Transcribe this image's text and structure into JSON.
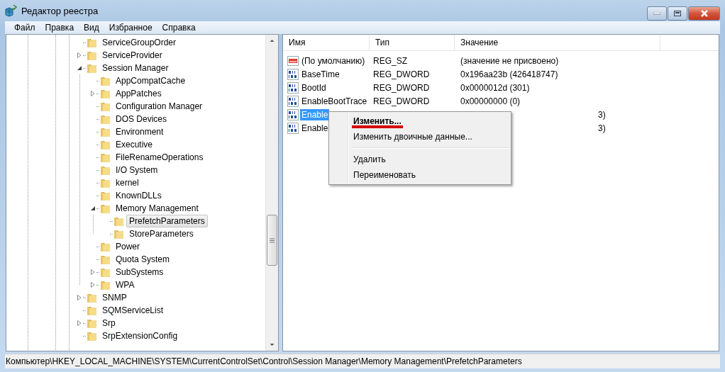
{
  "window": {
    "title": "Редактор реестра"
  },
  "menu": [
    "Файл",
    "Правка",
    "Вид",
    "Избранное",
    "Справка"
  ],
  "tree": [
    {
      "label": "ServiceGroupOrder",
      "selected": false
    },
    {
      "label": "ServiceProvider",
      "expanded": false,
      "selected": false
    },
    {
      "label": "Session Manager",
      "expanded": true,
      "selected": false,
      "children": [
        {
          "label": "AppCompatCache",
          "selected": false
        },
        {
          "label": "AppPatches",
          "expanded": false,
          "selected": false
        },
        {
          "label": "Configuration Manager",
          "selected": false
        },
        {
          "label": "DOS Devices",
          "selected": false
        },
        {
          "label": "Environment",
          "selected": false
        },
        {
          "label": "Executive",
          "selected": false
        },
        {
          "label": "FileRenameOperations",
          "selected": false
        },
        {
          "label": "I/O System",
          "selected": false
        },
        {
          "label": "kernel",
          "selected": false
        },
        {
          "label": "KnownDLLs",
          "selected": false
        },
        {
          "label": "Memory Management",
          "expanded": true,
          "selected": false,
          "children": [
            {
              "label": "PrefetchParameters",
              "selected": true
            },
            {
              "label": "StoreParameters",
              "selected": false
            }
          ]
        },
        {
          "label": "Power",
          "selected": false
        },
        {
          "label": "Quota System",
          "selected": false
        },
        {
          "label": "SubSystems",
          "expanded": false,
          "selected": false
        },
        {
          "label": "WPA",
          "expanded": false,
          "selected": false
        }
      ]
    },
    {
      "label": "SNMP",
      "expanded": false,
      "selected": false
    },
    {
      "label": "SQMServiceList",
      "selected": false
    },
    {
      "label": "Srp",
      "expanded": false,
      "selected": false
    },
    {
      "label": "SrpExtensionConfig",
      "selected": false
    }
  ],
  "table": {
    "columns": [
      "Имя",
      "Тип",
      "Значение"
    ],
    "rows": [
      {
        "kind": "string",
        "name": "(По умолчанию)",
        "type": "REG_SZ",
        "value": "(значение не присвоено)",
        "selected": false
      },
      {
        "kind": "dword",
        "name": "BaseTime",
        "type": "REG_DWORD",
        "value": "0x196aa23b (426418747)",
        "selected": false
      },
      {
        "kind": "dword",
        "name": "BootId",
        "type": "REG_DWORD",
        "value": "0x0000012d (301)",
        "selected": false
      },
      {
        "kind": "dword",
        "name": "EnableBootTrace",
        "type": "REG_DWORD",
        "value": "0x00000000 (0)",
        "selected": false
      },
      {
        "kind": "dword",
        "name": "Enable",
        "value": "3)",
        "selected": true
      },
      {
        "kind": "dword",
        "name": "Enable",
        "value": "3)",
        "selected": false
      }
    ]
  },
  "context_menu": [
    {
      "kind": "item",
      "label": "Изменить...",
      "default": true,
      "underlined": true
    },
    {
      "kind": "item",
      "label": "Изменить двоичные данные...",
      "default": false,
      "underlined": false
    },
    {
      "kind": "separator"
    },
    {
      "kind": "item",
      "label": "Удалить",
      "default": false,
      "underlined": false
    },
    {
      "kind": "item",
      "label": "Переименовать",
      "default": false,
      "underlined": false
    }
  ],
  "status_bar": "Компьютер\\HKEY_LOCAL_MACHINE\\SYSTEM\\CurrentControlSet\\Control\\Session Manager\\Memory Management\\PrefetchParameters"
}
